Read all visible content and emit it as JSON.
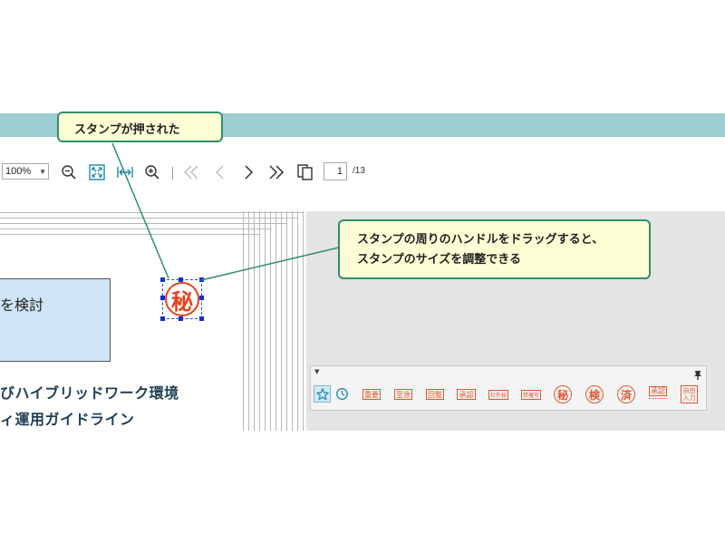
{
  "callouts": {
    "stamped": "スタンプが押された",
    "resize_line1": "スタンプの周りのハンドルをドラッグすると、",
    "resize_line2": "スタンプのサイズを調整できる"
  },
  "toolbar": {
    "zoom_value": "100%",
    "page_current": "1",
    "page_total": "/13",
    "icons": [
      "zoom-out-icon",
      "fit-page-icon",
      "fit-width-icon",
      "zoom-in-icon",
      "first-page-icon",
      "prev-page-icon",
      "next-page-icon",
      "last-page-icon",
      "page-layout-icon"
    ]
  },
  "document": {
    "box_text": "を検討",
    "heading_line1": "びハイブリッドワーク環境",
    "heading_line2": "ィ運用ガイドライン",
    "placed_stamp": "秘"
  },
  "palette": {
    "stamps": [
      {
        "label": "重要",
        "shape": "rect"
      },
      {
        "label": "至急",
        "shape": "rect"
      },
      {
        "label": "回覧",
        "shape": "rect"
      },
      {
        "label": "承認",
        "shape": "rect"
      },
      {
        "label": "社外秘",
        "shape": "rect"
      },
      {
        "label": "禁複写",
        "shape": "rect"
      },
      {
        "label": "秘",
        "shape": "circle"
      },
      {
        "label": "検",
        "shape": "circle"
      },
      {
        "label": "済",
        "shape": "circle"
      },
      {
        "label": "承認",
        "shape": "dated"
      },
      {
        "label": "自由入力",
        "shape": "free"
      }
    ]
  },
  "colors": {
    "titlebar": "#9ccdd0",
    "callout_border": "#2f8f6b",
    "callout_bg": "#ffffd6",
    "stamp_red": "#e5552e",
    "selection_blue": "#1030d0"
  }
}
